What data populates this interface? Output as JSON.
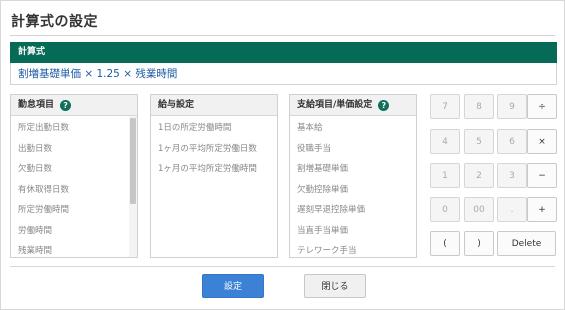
{
  "dialog": {
    "title": "計算式の設定"
  },
  "formula": {
    "header": "計算式",
    "expression": "割増基礎単価 × 1.25 × 残業時間"
  },
  "panels": {
    "attendance": {
      "header": "勤怠項目",
      "items": [
        "所定出勤日数",
        "出勤日数",
        "欠勤日数",
        "有休取得日数",
        "所定労働時間",
        "労働時間",
        "残業時間"
      ]
    },
    "salary": {
      "header": "給与設定",
      "items": [
        "1日の所定労働時間",
        "1ヶ月の平均所定労働日数",
        "1ヶ月の平均所定労働時間"
      ]
    },
    "payment": {
      "header": "支給項目/単価設定",
      "items": [
        "基本給",
        "役職手当",
        "割増基礎単価",
        "欠勤控除単価",
        "遅刻早退控除単価",
        "当直手当単価",
        "テレワーク手当"
      ]
    }
  },
  "keypad": {
    "row1": [
      "7",
      "8",
      "9",
      "÷"
    ],
    "row2": [
      "4",
      "5",
      "6",
      "×"
    ],
    "row3": [
      "1",
      "2",
      "3",
      "−"
    ],
    "row4": [
      "0",
      "00",
      ".",
      "+"
    ],
    "row5": [
      "(",
      ")",
      "Delete"
    ]
  },
  "buttons": {
    "ok": "設定",
    "close": "閉じる"
  },
  "colors": {
    "header_bg": "#066b56",
    "primary": "#3b82d6",
    "link": "#1d5aa6"
  }
}
